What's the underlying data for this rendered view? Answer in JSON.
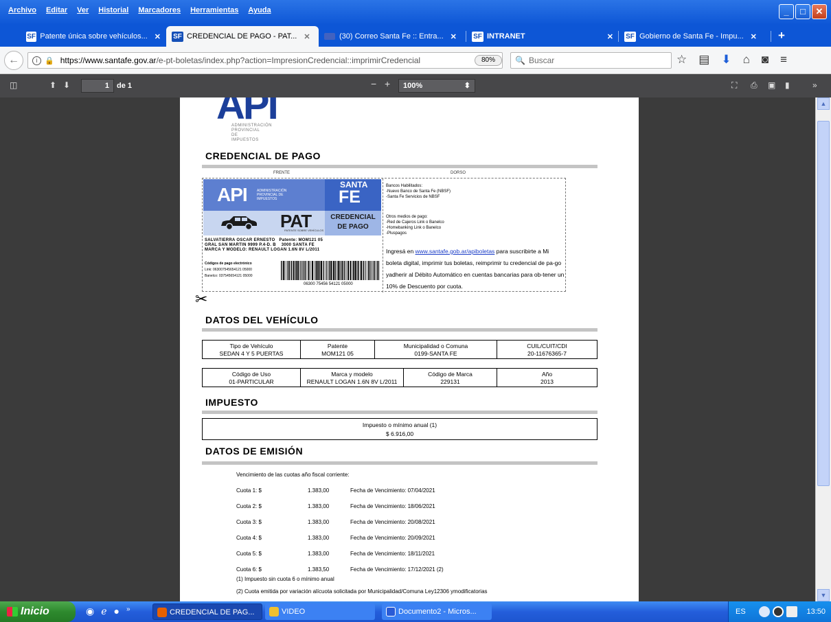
{
  "menu": [
    "Archivo",
    "Editar",
    "Ver",
    "Historial",
    "Marcadores",
    "Herramientas",
    "Ayuda"
  ],
  "tabs": [
    {
      "icon": "SF",
      "label": "Patente única sobre vehículos...",
      "active": false
    },
    {
      "icon": "SF",
      "label": "CREDENCIAL DE PAGO - PAT...",
      "active": true
    },
    {
      "icon": "mail",
      "label": "(30) Correo Santa Fe :: Entra...",
      "active": false
    },
    {
      "icon": "SF",
      "label": "INTRANET",
      "active": false
    },
    {
      "icon": "SF",
      "label": "Gobierno de Santa Fe - Impu...",
      "active": false
    }
  ],
  "nav": {
    "url_host": "https://www.santafe.gov.ar",
    "url_path": "/e-pt-boletas/index.php?action=ImpresionCredencial::imprimirCredencial",
    "zoom": "80%",
    "search_placeholder": "Buscar"
  },
  "pdf": {
    "page": "1",
    "of": "de 1",
    "zoom": "100%"
  },
  "doc": {
    "logo_text": "API",
    "logo_sub": "ADMINISTRACIÓN PROVINCIAL DE IMPUESTOS",
    "title": "CREDENCIAL DE PAGO",
    "frente": "FRENTE",
    "dorso": "DORSO",
    "card": {
      "api": "API",
      "api_sub": "ADMINISTRACIÓN PROVINCIAL DE IMPUESTOS",
      "santa": "SANTA",
      "fe": "FE",
      "pat": "PAT",
      "pat_sub": "PATENTE SOBRE VEHÍCULOS",
      "credencial": "CREDENCIAL",
      "de_pago": "DE PAGO",
      "owner_line1": "SALVATIERRA OSCAR ERNESTO",
      "patente_label": "Patente: MOM121 05",
      "owner_line2": "GRAL SAN MARTIN 9999 P.4-D. B",
      "city": "3000 SANTA FE",
      "model_line": "MARCA Y MODELO: RENAULT LOGAN 1.6N 8V L/2011",
      "codes_title": "Códigos de pago electrónico",
      "link": "Link: 063007545654121 05000",
      "banelco": "Banelco: 037545654121 05000",
      "barcode_num": "06300 75456 54121 05000",
      "back_bancos_title": "Bancos Habilitados:",
      "back_bancos": [
        "-Nuevo Banco de Santa Fe (NBSF)",
        "-Santa Fe Servicios de NBSF"
      ],
      "back_otros_title": "Otros medios de pago:",
      "back_otros": [
        "-Red de Cajeros Link o Banelco",
        "-Homebanking Link o Banelco",
        "-Pluspagos"
      ],
      "back_text_a": "Ingresá en ",
      "back_link": "www.santafe.gob.ar/apiboletas",
      "back_text_b": " para suscribirte a Mi boleta digital, imprimir tus boletas, reimprimir tu credencial de pa-go yadherir al Débito Automático en cuentas bancarias para ob-tener un 10% de Descuento por cuota."
    },
    "vehiculo_title": "DATOS DEL VEHÍCULO",
    "vehiculo_row1": [
      {
        "h": "Tipo de Vehículo",
        "v": "SEDAN 4 Y 5 PUERTAS"
      },
      {
        "h": "Patente",
        "v": "MOM121 05"
      },
      {
        "h": "Municipalidad o Comuna",
        "v": "0199-SANTA FE"
      },
      {
        "h": "CUIL/CUIT/CDI",
        "v": "20-11676365-7"
      }
    ],
    "vehiculo_row2": [
      {
        "h": "Código de Uso",
        "v": "01-PARTICULAR"
      },
      {
        "h": "Marca y modelo",
        "v": "RENAULT LOGAN 1.6N 8V L/2011"
      },
      {
        "h": "Código de Marca",
        "v": "229131"
      },
      {
        "h": "Año",
        "v": "2013"
      }
    ],
    "impuesto_title": "IMPUESTO",
    "impuesto_h": "Impuesto o mínimo anual (1)",
    "impuesto_v": "$ 6.916,00",
    "emision_title": "DATOS DE EMISIÓN",
    "emision_intro": "Vencimiento de las cuotas año fiscal corriente:",
    "cuotas": [
      {
        "c": "Cuota 1: $",
        "m": "1.383,00",
        "f": "Fecha de Vencimiento: 07/04/2021"
      },
      {
        "c": "Cuota 2: $",
        "m": "1.383,00",
        "f": "Fecha de Vencimiento: 18/06/2021"
      },
      {
        "c": "Cuota 3: $",
        "m": "1.383,00",
        "f": "Fecha de Vencimiento: 20/08/2021"
      },
      {
        "c": "Cuota 4: $",
        "m": "1.383,00",
        "f": "Fecha de Vencimiento: 20/09/2021"
      },
      {
        "c": "Cuota 5: $",
        "m": "1.383,00",
        "f": "Fecha de Vencimiento: 18/11/2021"
      },
      {
        "c": "Cuota 6: $",
        "m": "1.383,50",
        "f": "Fecha de Vencimiento: 17/12/2021 (2)"
      }
    ],
    "note1": "(1) Impuesto sin cuota 6 o mínimo anual",
    "note2": "(2) Cuota emitida por variación alícuota solicitada por Municipalidad/Comuna Ley12306 ymodificatorias"
  },
  "taskbar": {
    "start": "Inicio",
    "tasks": [
      "CREDENCIAL DE PAG...",
      "VIDEO",
      "Documento2 - Micros..."
    ],
    "lang": "ES",
    "clock": "13:50"
  }
}
